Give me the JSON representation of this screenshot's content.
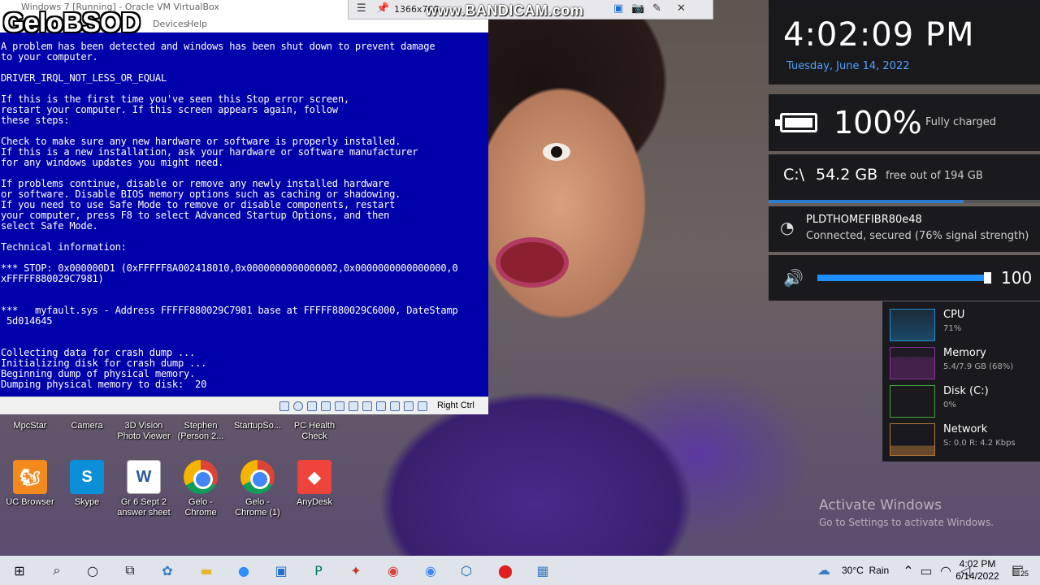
{
  "vbox": {
    "title": "Windows 7 [Running] - Oracle VM VirtualBox",
    "menu": [
      "Devices",
      "Help"
    ],
    "status_right": "Right Ctrl",
    "bsod_text": "A problem has been detected and windows has been shut down to prevent damage\nto your computer.\n\nDRIVER_IRQL_NOT_LESS_OR_EQUAL\n\nIf this is the first time you've seen this Stop error screen,\nrestart your computer. If this screen appears again, follow\nthese steps:\n\nCheck to make sure any new hardware or software is properly installed.\nIf this is a new installation, ask your hardware or software manufacturer\nfor any windows updates you might need.\n\nIf problems continue, disable or remove any newly installed hardware\nor software. Disable BIOS memory options such as caching or shadowing.\nIf you need to use Safe Mode to remove or disable components, restart\nyour computer, press F8 to select Advanced Startup Options, and then\nselect Safe Mode.\n\nTechnical information:\n\n*** STOP: 0x000000D1 (0xFFFFF8A002418010,0x0000000000000002,0x0000000000000000,0\nxFFFFF880029C7981)\n\n\n***   myfault.sys - Address FFFFF880029C7981 base at FFFFF880029C6000, DateStamp\n 5d014645\n\n\nCollecting data for crash dump ...\nInitializing disk for crash dump ...\nBeginning dump of physical memory.\nDumping physical memory to disk:  20"
  },
  "watermark": "GeloBSOD",
  "vm_toolbar": {
    "resolution": "1366x768"
  },
  "bandicam": "www.BANDICAM.com",
  "clock": {
    "time": "4:02:09 PM",
    "date": "Tuesday, June 14, 2022"
  },
  "battery": {
    "percent": "100%",
    "status": "Fully charged"
  },
  "disk": {
    "label": "C:\\",
    "free": "54.2 GB",
    "total": "free out of 194 GB",
    "used_fraction": 0.72
  },
  "wifi": {
    "ssid": "PLDTHOMEFIBR80e48",
    "status": "Connected, secured (76% signal strength)"
  },
  "volume": {
    "value": "100",
    "level": 1.0
  },
  "task_manager": [
    {
      "name": "CPU",
      "value": "71%",
      "color": "#1e90d6"
    },
    {
      "name": "Memory",
      "value": "5.4/7.9 GB (68%)",
      "color": "#8b2f9c"
    },
    {
      "name": "Disk (C:)",
      "value": "0%",
      "color": "#3cab3c"
    },
    {
      "name": "Network",
      "value": "S: 0.0 R: 4.2 Kbps",
      "color": "#b8793a"
    }
  ],
  "activate": {
    "line1": "Activate Windows",
    "line2": "Go to Settings to activate Windows."
  },
  "desktop_icons": [
    {
      "label": "MpcStar"
    },
    {
      "label": "Camera"
    },
    {
      "label": "3D Vision Photo Viewer"
    },
    {
      "label": "Stephen (Person 2..."
    },
    {
      "label": "StartupSo..."
    },
    {
      "label": "PC Health Check"
    },
    {
      "label": "UC Browser"
    },
    {
      "label": "Skype"
    },
    {
      "label": "Gr 6 Sept 2 answer sheet"
    },
    {
      "label": "Gelo - Chrome"
    },
    {
      "label": "Gelo - Chrome (1)"
    },
    {
      "label": "AnyDesk"
    }
  ],
  "taskbar": {
    "weather": "30°C  Rain",
    "time": "4:02 PM",
    "date": "6/14/2022",
    "notifications": "25"
  }
}
